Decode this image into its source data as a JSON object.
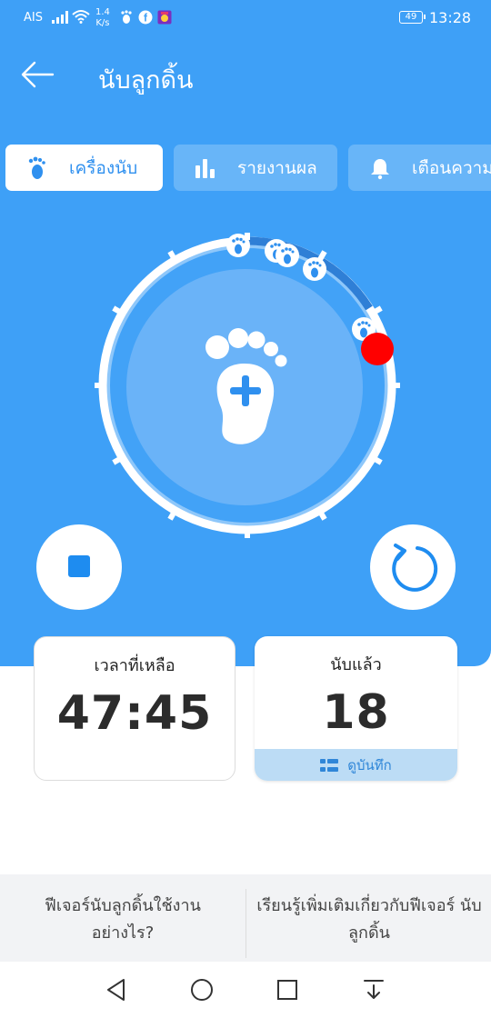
{
  "status_bar": {
    "carrier": "AIS",
    "speed_value": "1.4",
    "speed_unit": "K/s",
    "battery": "49",
    "time": "13:28",
    "icons": [
      "signal-icon",
      "wifi-icon",
      "baby-feet-app-icon",
      "facebook-icon",
      "game-app-icon"
    ]
  },
  "header": {
    "title": "นับลูกดิ้น",
    "back_icon": "arrow-left-icon"
  },
  "tabs": [
    {
      "label": "เครื่องนับ",
      "icon": "baby-foot-icon",
      "active": true
    },
    {
      "label": "รายงานผล",
      "icon": "bar-chart-icon",
      "active": false
    },
    {
      "label": "เตือนความ",
      "icon": "bell-icon",
      "active": false
    }
  ],
  "counter": {
    "button_icon": "foot-plus-icon",
    "kick_markers": 5,
    "progress_marker_color": "#ff0000",
    "stop_icon": "stop-icon",
    "reset_icon": "reset-icon"
  },
  "cards": {
    "remaining": {
      "label": "เวลาที่เหลือ",
      "value": "47:45"
    },
    "counted": {
      "label": "นับแล้ว",
      "value": "18",
      "view_log_label": "ดูบันทึก",
      "view_log_icon": "list-icon"
    }
  },
  "footer": {
    "left_link": "ฟีเจอร์นับลูกดิ้นใช้งาน อย่างไร?",
    "right_link": "เรียนรู้เพิ่มเติมเกี่ยวกับฟีเจอร์ นับลูกดิ้น"
  },
  "nav": [
    "back-nav-icon",
    "home-nav-icon",
    "recents-nav-icon",
    "notification-down-icon"
  ],
  "colors": {
    "primary": "#3ea0f7",
    "accent_blue": "#1e8cf0",
    "marker_red": "#ff0000"
  }
}
